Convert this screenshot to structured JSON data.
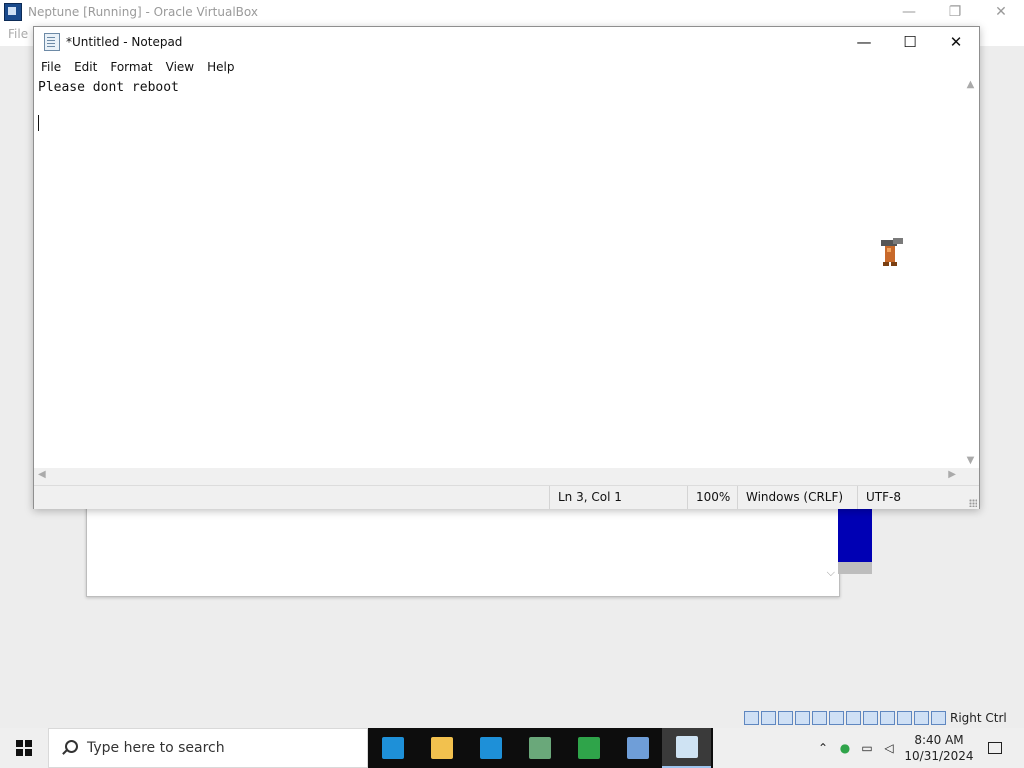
{
  "vbox": {
    "title": "Neptune [Running] - Oracle VirtualBox",
    "menu_file": "File",
    "controls": {
      "minimize": "—",
      "restore": "❐",
      "close": "✕"
    },
    "status_right_ctrl": "Right Ctrl"
  },
  "notepad": {
    "title": "*Untitled - Notepad",
    "controls": {
      "minimize": "—",
      "maximize": "☐",
      "close": "✕"
    },
    "menu": [
      "File",
      "Edit",
      "Format",
      "View",
      "Help"
    ],
    "content": "Please dont reboot",
    "status": {
      "position": "Ln 3, Col 1",
      "zoom": "100%",
      "line_ending": "Windows (CRLF)",
      "encoding": "UTF-8"
    }
  },
  "taskbar": {
    "search_placeholder": "Type here to search",
    "apps": [
      {
        "name": "visual-studio",
        "color": "#1e90d8"
      },
      {
        "name": "file-explorer",
        "color": "#f2c14e"
      },
      {
        "name": "visual-studio-2",
        "color": "#1e90d8"
      },
      {
        "name": "document-viewer",
        "color": "#6aa87a"
      },
      {
        "name": "users-manager",
        "color": "#2fa44a"
      },
      {
        "name": "windows-2000",
        "color": "#6f9ed8"
      },
      {
        "name": "notepad",
        "color": "#cfe3f3"
      }
    ],
    "clock": {
      "time": "8:40 AM",
      "date": "10/31/2024"
    }
  }
}
